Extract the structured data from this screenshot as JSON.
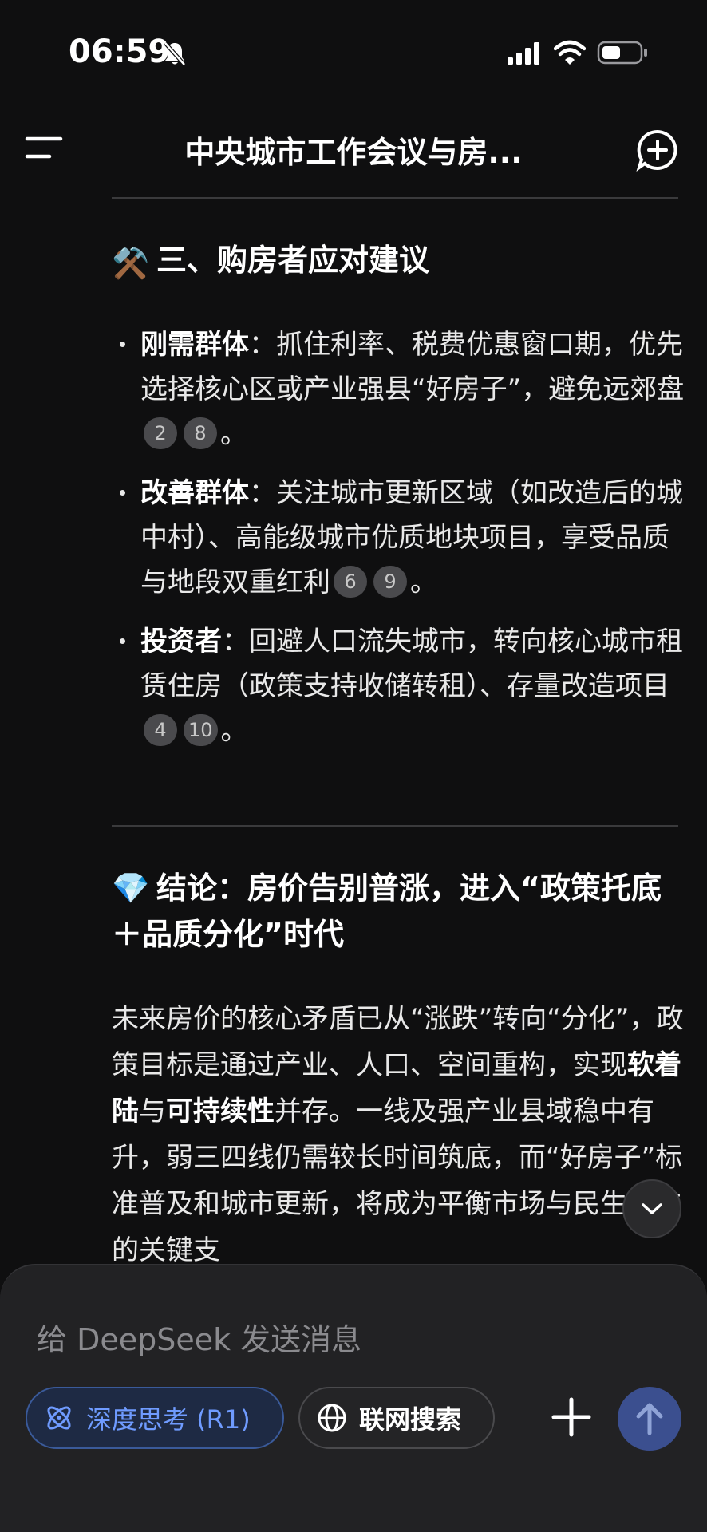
{
  "status_bar": {
    "time": "06:59",
    "icons": [
      "bell-slash-icon",
      "signal-icon",
      "wifi-icon",
      "battery-icon"
    ]
  },
  "header": {
    "title": "中央城市工作会议与房...",
    "menu_icon": "menu-icon",
    "new_chat_icon": "new-chat-icon"
  },
  "section3": {
    "emoji": "⚒️",
    "title": "三、购房者应对建议",
    "items": [
      {
        "term": "刚需群体",
        "sep": "：",
        "text": "抓住利率、税费优惠窗口期，优先选择核心区或产业强县“好房子”，避免远郊盘",
        "citations": [
          "2",
          "8"
        ],
        "end": "。"
      },
      {
        "term": "改善群体",
        "sep": "：",
        "text": "关注城市更新区域（如改造后的城中村）、高能级城市优质地块项目，享受品质与地段双重红利",
        "citations": [
          "6",
          "9"
        ],
        "end": "。"
      },
      {
        "term": "投资者",
        "sep": "：",
        "text": "回避人口流失城市，转向核心城市租赁住房（政策支持收储转租）、存量改造项目",
        "citations": [
          "4",
          "10"
        ],
        "end": "。"
      }
    ]
  },
  "conclusion": {
    "emoji": "💎",
    "title": "结论：房价告别普涨，进入“政策托底＋品质分化”时代",
    "p1": "未来房价的核心矛盾已从“涨跌”转向“分化”，政策目标是通过产业、人口、空间重构，实现",
    "b1": "软着陆",
    "p2": "与",
    "b2": "可持续性",
    "p3": "并存。一线及强产业县域稳中有升，弱三四线仍需较长时间筑底，而“好房子”标准普及和城市更新，将成为平衡市场与民生诉求的关键支"
  },
  "composer": {
    "placeholder": "给 DeepSeek 发送消息",
    "deepthink_label": "深度思考 (R1)",
    "search_label": "联网搜索",
    "accent_color": "#6f9bff"
  }
}
